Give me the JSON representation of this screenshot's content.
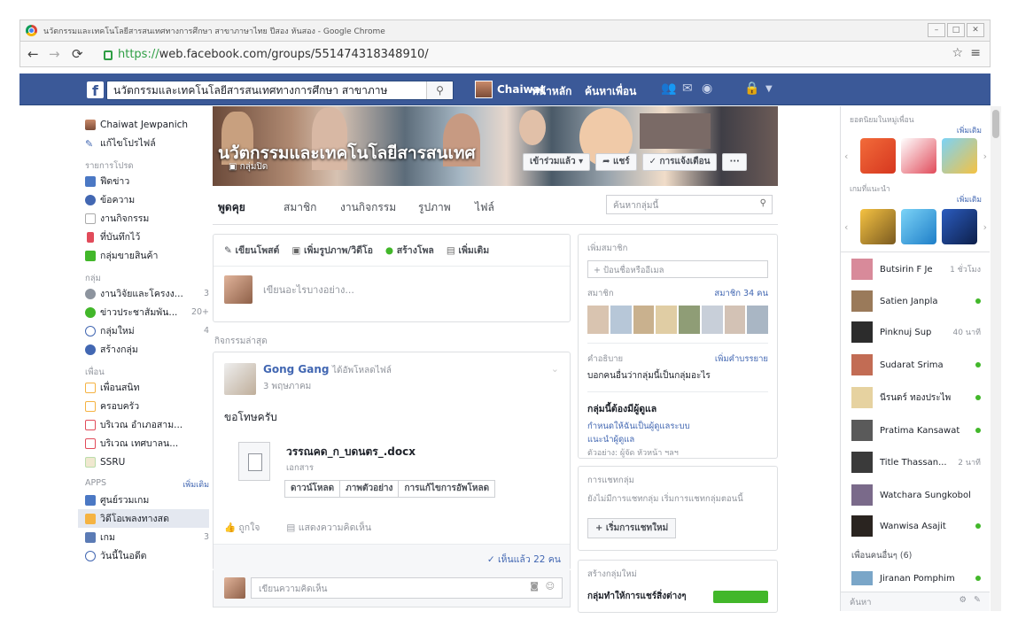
{
  "browser": {
    "window_title": "นวัตกรรมและเทคโนโลยีสารสนเทศทางการศึกษา สาขาภาษาไทย ปีสอง หันสอง - Google Chrome",
    "url_protocol": "https://",
    "url_rest": "web.facebook.com/groups/551474318348910/"
  },
  "topbar": {
    "search_value": "นวัตกรรมและเทคโนโลยีสารสนเทศทางการศึกษา สาขาภาษ",
    "user_name": "Chaiwat",
    "nav_home": "หน้าหลัก",
    "nav_find_friends": "ค้นหาเพื่อน"
  },
  "sidebar": {
    "profile_name": "Chaiwat Jewpanich",
    "edit_profile": "แก้ไขโปรไฟล์",
    "favorites_label": "รายการโปรด",
    "favorites": [
      {
        "label": "ฟีดข่าว",
        "color": "#4b78c4"
      },
      {
        "label": "ข้อความ",
        "color": "#4267b2"
      },
      {
        "label": "งานกิจกรรม",
        "color": "#e4e6ea"
      },
      {
        "label": "ที่บันทึกไว้",
        "color": "#e14b5a"
      },
      {
        "label": "กลุ่มขายสินค้า",
        "color": "#42b72a"
      }
    ],
    "groups_label": "กลุ่ม",
    "groups": [
      {
        "label": "งานวิจัยและโครงง...",
        "count": "3"
      },
      {
        "label": "ข่าวประชาสัมพัน...",
        "count": "20+"
      },
      {
        "label": "กลุ่มใหม่",
        "count": "4"
      },
      {
        "label": "สร้างกลุ่ม",
        "count": ""
      }
    ],
    "friends_label": "เพื่อน",
    "friends": [
      {
        "label": "เพื่อนสนิท"
      },
      {
        "label": "ครอบครัว"
      },
      {
        "label": "บริเวณ อำเภอสาม..."
      },
      {
        "label": "บริเวณ เทศบาลน..."
      },
      {
        "label": "SSRU"
      }
    ],
    "apps_label": "APPS",
    "apps_more": "เพิ่มเติม",
    "apps": [
      {
        "label": "ศูนย์รวมเกม",
        "count": ""
      },
      {
        "label": "วิดีโอเพลงทางสด",
        "count": ""
      },
      {
        "label": "เกม",
        "count": "3"
      },
      {
        "label": "วันนี้ในอดีต",
        "count": ""
      }
    ]
  },
  "cover": {
    "group_name": "นวัตกรรมและเทคโนโลยีสารสนเทศ",
    "closed_label": "กลุ่มปิด",
    "joined_button": "เข้าร่วมแล้ว ▾",
    "share_button": "➦ แชร์",
    "notify_button": "✓ การแจ้งเตือน",
    "more_button": "···"
  },
  "tabs": {
    "items": [
      "พูดคุย",
      "สมาชิก",
      "งานกิจกรรม",
      "รูปภาพ",
      "ไฟล์"
    ],
    "search_placeholder": "ค้นหากลุ่มนี้"
  },
  "composer": {
    "write_post": "เขียนโพสต์",
    "add_photo": "เพิ่มรูปภาพ/วิดีโอ",
    "create_poll": "สร้างโพล",
    "more": "เพิ่มเติม",
    "placeholder": "เขียนอะไรบางอย่าง..."
  },
  "activity_label": "กิจกรรมล่าสุด",
  "post": {
    "author": "Gong Gang",
    "action": "ได้อัพโหลดไฟล์",
    "date": "3 พฤษภาคม",
    "text": "ขอโทษครับ",
    "file_name": "วรรณคด_ก_บดนตร_.docx",
    "file_type": "เอกสาร",
    "btn_download": "ดาวน์โหลด",
    "btn_preview": "ภาพตัวอย่าง",
    "btn_revisions": "การแก้ไขการอัพโหลด",
    "like": "ถูกใจ",
    "comment": "แสดงความคิดเห็น",
    "seen": "✓ เห็นแล้ว 22 คน",
    "comment_placeholder": "เขียนความคิดเห็น"
  },
  "members": {
    "add_label": "เพิ่มสมาชิก",
    "add_placeholder": "+ ป้อนชื่อหรืออีเมล",
    "members_label": "สมาชิก",
    "members_count": "สมาชิก 34 คน",
    "desc_label": "คำอธิบาย",
    "desc_link": "เพิ่มคำบรรยาย",
    "desc_text": "บอกคนอื่นว่ากลุ่มนี้เป็นกลุ่มอะไร",
    "admin_title": "กลุ่มนี้ต้องมีผู้ดูแล",
    "admin_link1": "กำหนดให้ฉันเป็นผู้ดูแลระบบ",
    "admin_link2": "แนะนำผู้ดูแล",
    "admin_hint": "ตัวอย่าง: ผู้จัด หัวหน้า ฯลฯ"
  },
  "chatbox": {
    "label": "การแชทกลุ่ม",
    "text": "ยังไม่มีการแชทกลุ่ม เริ่มการแชทกลุ่มตอนนี้",
    "button": "+ เริ่มการแชทใหม่"
  },
  "newgroup": {
    "label": "สร้างกลุ่มใหม่",
    "text": "กลุ่มทำให้การแชร์สิ่งต่างๆ"
  },
  "rightbar": {
    "games_label": "ยอดนิยมในหมู่เพื่อน",
    "games_more": "เพิ่มเติม",
    "games2_label": "เกมที่แนะนำ",
    "games2_more": "เพิ่มเติม",
    "contacts": [
      {
        "name": "Butsirin F Je",
        "status": "1 ชั่วโมง"
      },
      {
        "name": "Satien Janpla",
        "status": "online"
      },
      {
        "name": "Pinknuj Sup",
        "status": "40 นาที"
      },
      {
        "name": "Sudarat Srima",
        "status": "online"
      },
      {
        "name": "นีรนดร์ ทองประไพ",
        "status": "online"
      },
      {
        "name": "Pratima Kansawat",
        "status": "online"
      },
      {
        "name": "Title Thassan...",
        "status": "2 นาที"
      },
      {
        "name": "Watchara Sungkobol",
        "status": ""
      },
      {
        "name": "Wanwisa Asajit",
        "status": "online"
      }
    ],
    "other_friends": "เพื่อนคนอื่นๆ (6)",
    "last_contact": "Jiranan Pomphim",
    "search_placeholder": "ค้นหา"
  }
}
